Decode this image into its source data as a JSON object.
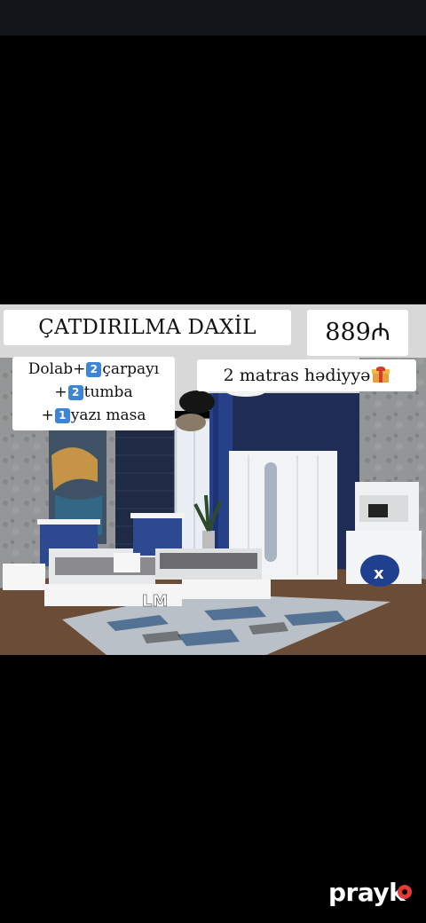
{
  "post": {
    "delivery_label": "ÇATDIRILMA DAXİL",
    "price_label": "889₼",
    "set_lines": [
      {
        "prefix": "Dolab+",
        "count": "2",
        "item": "çarpayı"
      },
      {
        "prefix": "+",
        "count": "2",
        "item": "tumba"
      },
      {
        "prefix": "+",
        "count": "1",
        "item": "yazı masa"
      }
    ],
    "gift_label": "2 matras hədiyyə",
    "gift_icon": "gift-icon",
    "photo_marks": {
      "bed_logo": "LM",
      "pouf_mark": "x"
    }
  },
  "brand": {
    "name": "prayk",
    "dot_color": "#e5383b"
  },
  "colors": {
    "accent_blue": "#2b3f86",
    "badge_blue": "#3d86d6"
  }
}
